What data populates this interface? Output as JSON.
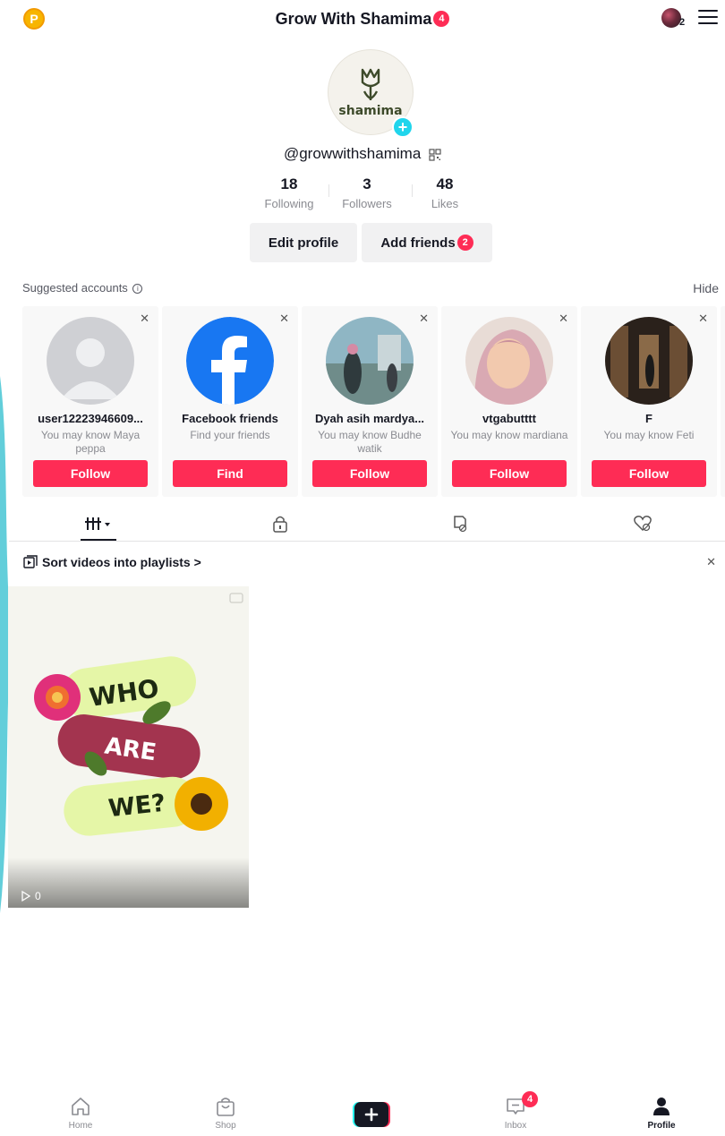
{
  "header": {
    "points_label": "P",
    "title": "Grow With Shamima",
    "title_badge": "4",
    "account_count": "2"
  },
  "profile": {
    "logo_text": "shamima",
    "username": "@growwithshamima",
    "stats": [
      {
        "value": "18",
        "label": "Following"
      },
      {
        "value": "3",
        "label": "Followers"
      },
      {
        "value": "48",
        "label": "Likes"
      }
    ],
    "edit_label": "Edit profile",
    "add_friends_label": "Add friends",
    "add_friends_badge": "2"
  },
  "suggested": {
    "title": "Suggested accounts",
    "hide_label": "Hide",
    "cards": [
      {
        "name": "user12223946609...",
        "subtitle": "You may know Maya peppa",
        "action": "Follow"
      },
      {
        "name": "Facebook friends",
        "subtitle": "Find your friends",
        "action": "Find"
      },
      {
        "name": "Dyah asih mardya...",
        "subtitle": "You may know Budhe watik",
        "action": "Follow"
      },
      {
        "name": "vtgabutttt",
        "subtitle": "You may know mardiana",
        "action": "Follow"
      },
      {
        "name": "F",
        "subtitle": "You may know Feti",
        "action": "Follow"
      }
    ]
  },
  "content": {
    "playlist_prompt": "Sort videos into playlists >",
    "video": {
      "words": [
        "WHO",
        "ARE",
        "WE?"
      ],
      "views": "0"
    }
  },
  "bottom_nav": {
    "items": [
      {
        "label": "Home"
      },
      {
        "label": "Shop"
      },
      {
        "label": "Inbox"
      },
      {
        "label": "Profile"
      }
    ],
    "inbox_badge": "4"
  }
}
